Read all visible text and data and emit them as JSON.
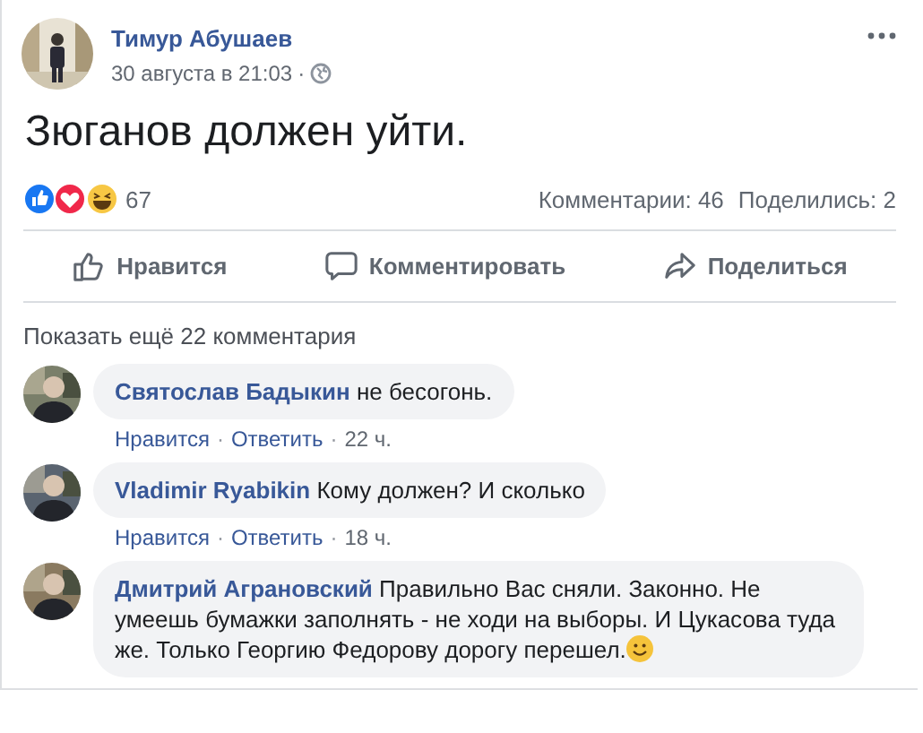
{
  "post": {
    "author": "Тимур Абушаев",
    "date": "30 августа в 21:03",
    "separator": "·",
    "text": "Зюганов должен уйти.",
    "reaction_count": "67",
    "comments_count": "Комментарии: 46",
    "shares_count": "Поделились: 2"
  },
  "actions": [
    {
      "kind": "like",
      "label": "Нравится"
    },
    {
      "kind": "comment",
      "label": "Комментировать"
    },
    {
      "kind": "share",
      "label": "Поделиться"
    }
  ],
  "show_more": "Показать ещё 22 комментария",
  "comments": [
    {
      "author": "Святослав Бадыкин",
      "text": "не бесогонь.",
      "emoji": false,
      "like": "Нравится",
      "separator": "·",
      "reply": "Ответить",
      "time": "22 ч."
    },
    {
      "author": "Vladimir Ryabikin",
      "text": "Кому должен? И сколько",
      "emoji": false,
      "like": "Нравится",
      "separator": "·",
      "reply": "Ответить",
      "time": "18 ч."
    },
    {
      "author": "Дмитрий Аграновский",
      "text": "Правильно Вас сняли. Законно. Не умеешь бумажки заполнять - не ходи на выборы. И Цукасова туда же. Только Георгию Федорову дорогу перешел.",
      "emoji": true
    }
  ]
}
